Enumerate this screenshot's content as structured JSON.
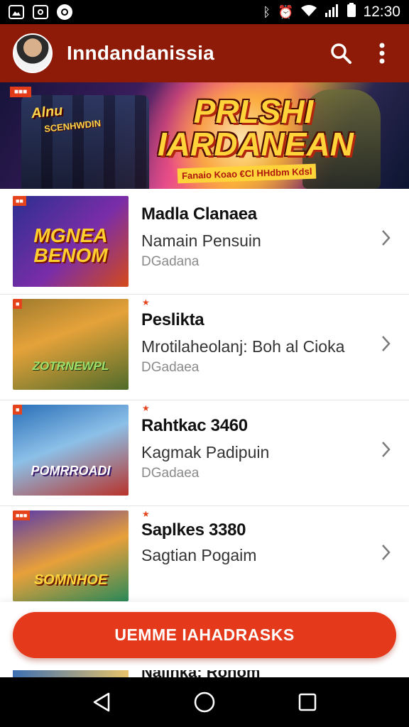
{
  "status_bar": {
    "time": "12:30",
    "left_icons": [
      "image-icon",
      "camera-icon",
      "sync-icon"
    ],
    "right_icons": [
      "bluetooth-icon",
      "alarm-icon",
      "wifi-icon",
      "signal-icon",
      "battery-icon"
    ]
  },
  "app_bar": {
    "title": "Inndandanissia",
    "icons": [
      "search-icon",
      "more-vert-icon"
    ],
    "color": "#8e1a08"
  },
  "banner": {
    "badge": "■■■",
    "left_title": "Alnu",
    "left_sub": "SCENHWDIN",
    "main_title_line1": "PRLSHI",
    "main_title_line2": "IARDANEAN",
    "tagline": "Fanaio Koao €Cl HHdbm Kdsl"
  },
  "items": [
    {
      "thumb_text": "MGNEA BENOM",
      "badge": "■■",
      "title": "Madla Clanaea",
      "subtitle": "Namain Pensuin",
      "meta": "DGadana",
      "thumb_colors": [
        "#2b2f8f",
        "#7a2da8",
        "#d44a1a"
      ]
    },
    {
      "thumb_text": "ZOTRNEWPL",
      "badge": "■",
      "title": "Peslikta",
      "subtitle": "Mrotilaheolanj: Boh al Cioka",
      "meta": "DGadaea",
      "thumb_colors": [
        "#9f7b2e",
        "#4f6b2a",
        "#e5a23a"
      ]
    },
    {
      "thumb_text": "POMRROADI",
      "badge": "■",
      "title": "Rahtkac 3460",
      "subtitle": "Kagmak Padipuin",
      "meta": "DGadaea",
      "thumb_colors": [
        "#2a6fb8",
        "#8cc0e8",
        "#b8322a"
      ]
    },
    {
      "thumb_text": "SOMNHOE",
      "badge": "■■■",
      "title": "Saplkes 3380",
      "subtitle": "Sagtian Pogaim",
      "meta": "",
      "thumb_colors": [
        "#5a3aa8",
        "#2a8a5a",
        "#e8a03a"
      ]
    }
  ],
  "cta": {
    "label": "UEMME IAHADRASKS",
    "color": "#e5391b"
  },
  "peek": {
    "text": "Naiinka: Ronom"
  },
  "nav_bar": {
    "buttons": [
      "back-icon",
      "home-icon",
      "recents-icon"
    ]
  }
}
